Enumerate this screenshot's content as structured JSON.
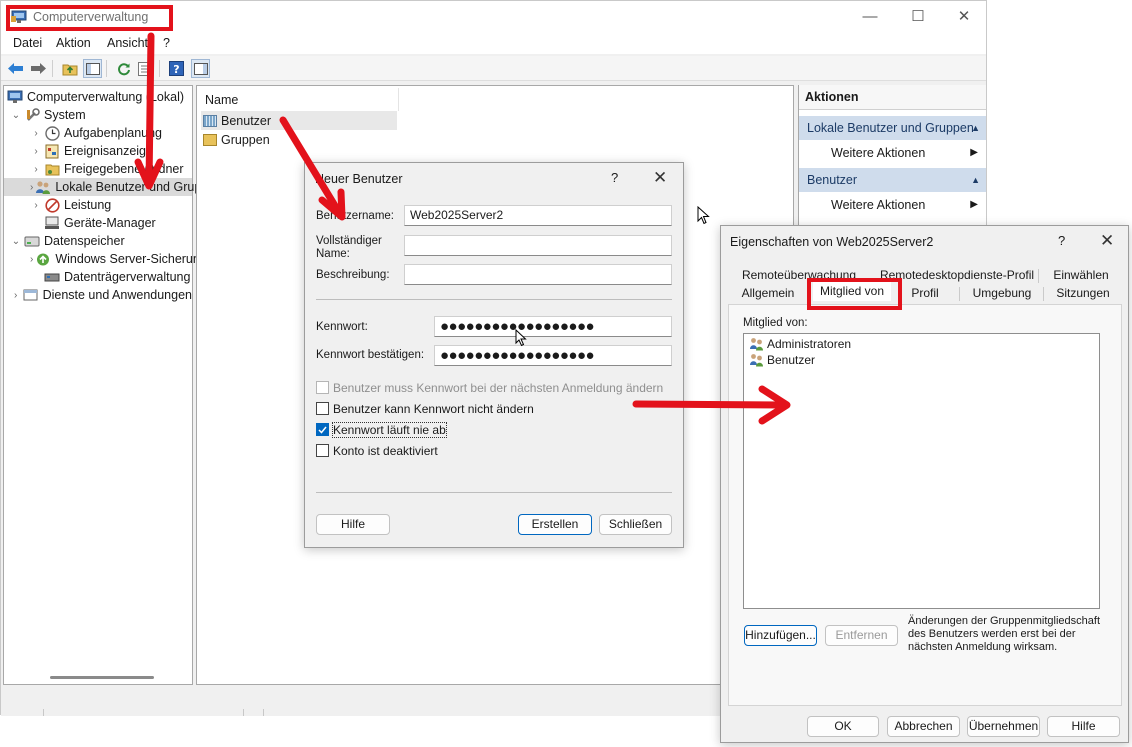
{
  "main_window": {
    "title": "Computerverwaltung",
    "controls": {
      "minimize": "—",
      "maximize": "☐",
      "close": "✕"
    },
    "menu": [
      "Datei",
      "Aktion",
      "Ansicht",
      "?"
    ],
    "tree": [
      {
        "label": "Computerverwaltung (Lokal)",
        "icon": "computer-management-icon",
        "expander": ""
      },
      {
        "label": "System",
        "icon": "tools-icon",
        "expander": "⌄"
      },
      {
        "label": "Aufgabenplanung",
        "icon": "clock-icon",
        "expander": "›"
      },
      {
        "label": "Ereignisanzeige",
        "icon": "event-viewer-icon",
        "expander": "›"
      },
      {
        "label": "Freigegebene Ordner",
        "icon": "shared-folder-icon",
        "expander": "›"
      },
      {
        "label": "Lokale Benutzer und Gruppen",
        "icon": "users-icon",
        "expander": "›"
      },
      {
        "label": "Leistung",
        "icon": "performance-icon",
        "expander": "›"
      },
      {
        "label": "Geräte-Manager",
        "icon": "device-manager-icon",
        "expander": ""
      },
      {
        "label": "Datenspeicher",
        "icon": "storage-icon",
        "expander": "⌄"
      },
      {
        "label": "Windows Server-Sicherung",
        "icon": "backup-icon",
        "expander": "›"
      },
      {
        "label": "Datenträgerverwaltung",
        "icon": "disk-icon",
        "expander": ""
      },
      {
        "label": "Dienste und Anwendungen",
        "icon": "services-icon",
        "expander": "›"
      }
    ],
    "list": {
      "column_name": "Name",
      "rows": [
        "Benutzer",
        "Gruppen"
      ]
    },
    "actions": {
      "header": "Aktionen",
      "group1": "Lokale Benutzer und Gruppen",
      "group1_item": "Weitere Aktionen",
      "group2": "Benutzer",
      "group2_item": "Weitere Aktionen"
    }
  },
  "new_user_dialog": {
    "title": "Neuer Benutzer",
    "help": "?",
    "close": "✕",
    "username_label": "Benutzername:",
    "username_value": "Web2025Server2",
    "fullname_label": "Vollständiger Name:",
    "fullname_value": "",
    "description_label": "Beschreibung:",
    "description_value": "",
    "password_label": "Kennwort:",
    "password_value": "●●●●●●●●●●●●●●●●●●",
    "confirm_label": "Kennwort bestätigen:",
    "confirm_value": "●●●●●●●●●●●●●●●●●●",
    "options": [
      {
        "label": "Benutzer muss Kennwort bei der nächsten Anmeldung ändern",
        "checked": false,
        "disabled": true
      },
      {
        "label": "Benutzer kann Kennwort nicht ändern",
        "checked": false,
        "disabled": false
      },
      {
        "label": "Kennwort läuft nie ab",
        "checked": true,
        "disabled": false
      },
      {
        "label": "Konto ist deaktiviert",
        "checked": false,
        "disabled": false
      }
    ],
    "help_button": "Hilfe",
    "create_button": "Erstellen",
    "close_button": "Schließen"
  },
  "properties_dialog": {
    "title": "Eigenschaften von Web2025Server2",
    "help": "?",
    "close": "✕",
    "tabs_row1": [
      "Remoteüberwachung",
      "Remotedesktopdienste-Profil",
      "Einwählen"
    ],
    "tabs_row2": [
      "Allgemein",
      "Mitglied von",
      "Profil",
      "Umgebung",
      "Sitzungen"
    ],
    "active_tab": "Mitglied von",
    "member_of_label": "Mitglied von:",
    "members": [
      "Administratoren",
      "Benutzer"
    ],
    "add_button": "Hinzufügen...",
    "remove_button": "Entfernen",
    "note": "Änderungen der Gruppenmitgliedschaft des Benutzers werden erst bei der nächsten Anmeldung wirksam.",
    "ok_button": "OK",
    "cancel_button": "Abbrechen",
    "apply_button": "Übernehmen",
    "help_button": "Hilfe"
  },
  "annotation_color": "#e3121b",
  "selection_color": "#cfdcec"
}
